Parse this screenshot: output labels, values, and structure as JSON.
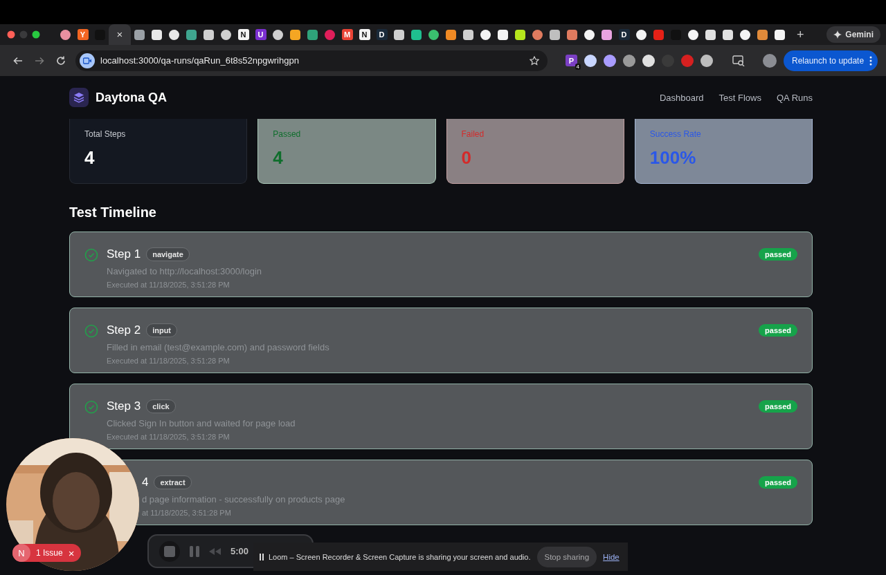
{
  "browser": {
    "tabs": [
      {
        "kind": "icon",
        "color": "#e88fa0"
      },
      {
        "kind": "letter",
        "glyph": "Y",
        "color": "#f26522"
      },
      {
        "kind": "icon",
        "color": "#111111"
      },
      {
        "kind": "active",
        "close": "×"
      },
      {
        "kind": "icon",
        "color": "#9aa0a6"
      },
      {
        "kind": "icon",
        "color": "#e8e8e8"
      },
      {
        "kind": "icon",
        "color": "#e8e8e8"
      },
      {
        "kind": "icon",
        "color": "#3fa58f"
      },
      {
        "kind": "icon",
        "color": "#cfcfcf"
      },
      {
        "kind": "icon",
        "color": "#cfcfcf"
      },
      {
        "kind": "letter",
        "glyph": "N",
        "color": "#f4f4f4"
      },
      {
        "kind": "letter",
        "glyph": "U",
        "color": "#7b2fd0"
      },
      {
        "kind": "icon",
        "color": "#cfcfcf"
      },
      {
        "kind": "icon",
        "color": "#f5a623"
      },
      {
        "kind": "icon",
        "color": "#2fa37a"
      },
      {
        "kind": "icon",
        "color": "#e01e5a"
      },
      {
        "kind": "letter",
        "glyph": "M",
        "color": "#ea4335"
      },
      {
        "kind": "letter",
        "glyph": "N",
        "color": "#f4f4f4"
      },
      {
        "kind": "letter",
        "glyph": "D",
        "color": "#1a2a3a"
      },
      {
        "kind": "icon",
        "color": "#cfcfcf"
      },
      {
        "kind": "icon",
        "color": "#1fbf8f"
      },
      {
        "kind": "icon",
        "color": "#3ac06e"
      },
      {
        "kind": "icon",
        "color": "#f08a24"
      },
      {
        "kind": "icon",
        "color": "#cfcfcf"
      },
      {
        "kind": "icon",
        "color": "#f4f4f4"
      },
      {
        "kind": "icon",
        "color": "#f4f4f4"
      },
      {
        "kind": "icon",
        "color": "#b5e61d"
      },
      {
        "kind": "icon",
        "color": "#e07b5f"
      },
      {
        "kind": "icon",
        "color": "#bfbfbf"
      },
      {
        "kind": "icon",
        "color": "#e07b5f"
      },
      {
        "kind": "icon",
        "color": "#f4f4f4"
      },
      {
        "kind": "icon",
        "color": "#e9a3e0"
      },
      {
        "kind": "letter",
        "glyph": "D",
        "color": "#1a2a3a"
      },
      {
        "kind": "icon",
        "color": "#f4f4f4"
      },
      {
        "kind": "icon",
        "color": "#e62117"
      },
      {
        "kind": "icon",
        "color": "#111111"
      },
      {
        "kind": "icon",
        "color": "#f4f4f4"
      },
      {
        "kind": "icon",
        "color": "#e0e0e0"
      },
      {
        "kind": "icon",
        "color": "#e0e0e0"
      },
      {
        "kind": "icon",
        "color": "#f4f4f4"
      },
      {
        "kind": "icon",
        "color": "#e08a3a"
      },
      {
        "kind": "icon",
        "color": "#f4f4f4"
      }
    ],
    "new_tab": "+",
    "gemini": "Gemini",
    "url": "localhost:3000/qa-runs/qaRun_6t8s52npgwrihgpn",
    "extensions": [
      {
        "kind": "letter",
        "glyph": "P",
        "color": "#7b3fc4",
        "badge": "4"
      },
      {
        "kind": "icon",
        "color": "#c9d6ff"
      },
      {
        "kind": "icon",
        "color": "#a99cff"
      },
      {
        "kind": "icon",
        "color": "#9a9a9a"
      },
      {
        "kind": "icon",
        "color": "#e0e0e0"
      },
      {
        "kind": "icon",
        "color": "#3a3a3a"
      },
      {
        "kind": "icon",
        "color": "#d62020"
      },
      {
        "kind": "icon",
        "color": "#bdbdbd"
      }
    ],
    "relaunch": "Relaunch to update"
  },
  "app": {
    "brand": "Daytona QA",
    "nav": [
      "Dashboard",
      "Test Flows",
      "QA Runs"
    ]
  },
  "stats": [
    {
      "kind": "total",
      "label": "Total Steps",
      "value": "4"
    },
    {
      "kind": "passed",
      "label": "Passed",
      "value": "4"
    },
    {
      "kind": "failed",
      "label": "Failed",
      "value": "0"
    },
    {
      "kind": "rate",
      "label": "Success Rate",
      "value": "100%"
    }
  ],
  "timeline": {
    "title": "Test Timeline",
    "steps": [
      {
        "title": "Step 1",
        "action": "navigate",
        "description": "Navigated to http://localhost:3000/login",
        "time": "Executed at 11/18/2025, 3:51:28 PM",
        "status": "passed",
        "check_icon": true
      },
      {
        "title": "Step 2",
        "action": "input",
        "description": "Filled in email (test@example.com) and password fields",
        "time": "Executed at 11/18/2025, 3:51:28 PM",
        "status": "passed",
        "check_icon": true
      },
      {
        "title": "Step 3",
        "action": "click",
        "description": "Clicked Sign In button and waited for page load",
        "time": "Executed at 11/18/2025, 3:51:28 PM",
        "status": "passed",
        "check_icon": true
      },
      {
        "title": "4",
        "action": "extract",
        "description": "d page information - successfully on products page",
        "time": "at 11/18/2025, 3:51:28 PM",
        "status": "passed",
        "check_icon": false
      }
    ]
  },
  "recorder": {
    "timer": "5:00",
    "message": "Loom – Screen Recorder & Screen Capture is sharing your screen and audio.",
    "stop": "Stop sharing",
    "hide": "Hide"
  },
  "issues": {
    "avatar": "N",
    "label": "1 Issue",
    "close": "×"
  }
}
